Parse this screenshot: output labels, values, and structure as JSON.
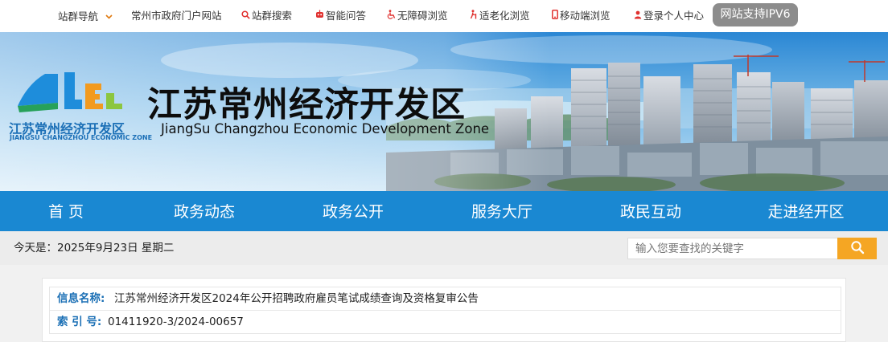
{
  "topbar": {
    "items": [
      {
        "label": "站群导航",
        "icon": "chevron-down-icon"
      },
      {
        "label": "常州市政府门户网站"
      },
      {
        "label": "站群搜索",
        "icon": "search-icon"
      },
      {
        "label": "智能问答",
        "icon": "robot-icon"
      },
      {
        "label": "无障碍浏览",
        "icon": "wheelchair-icon"
      },
      {
        "label": "适老化浏览",
        "icon": "elder-icon"
      },
      {
        "label": "移动端浏览",
        "icon": "mobile-icon"
      },
      {
        "label": "登录个人中心",
        "icon": "user-icon"
      }
    ],
    "ipv6_badge": "网站支持IPV6"
  },
  "banner": {
    "title": "江苏常州经济开发区",
    "subtitle": "JiangSu Changzhou Economic Development Zone",
    "logo_cn": "江苏常州经济开发区",
    "logo_en": "JIANGSU CHANGZHOU ECONOMIC ZONE"
  },
  "nav": {
    "items": [
      "首 页",
      "政务动态",
      "政务公开",
      "服务大厅",
      "政民互动",
      "走进经开区"
    ]
  },
  "daterow": {
    "date_text": "今天是：2025年9月23日 星期二",
    "search_placeholder": "输入您要查找的关键字"
  },
  "content": {
    "rows": [
      {
        "label": "信息名称:",
        "value": "江苏常州经济开发区2024年公开招聘政府雇员笔试成绩查询及资格复审公告"
      },
      {
        "label": "索 引 号:",
        "value": "01411920-3/2024-00657"
      }
    ]
  },
  "colors": {
    "nav_bg": "#1a88d2",
    "label_blue": "#1a6fb5",
    "search_button": "#f5a623",
    "topbar_icon_red": "#e0312f",
    "chevron_orange": "#e07a10"
  }
}
